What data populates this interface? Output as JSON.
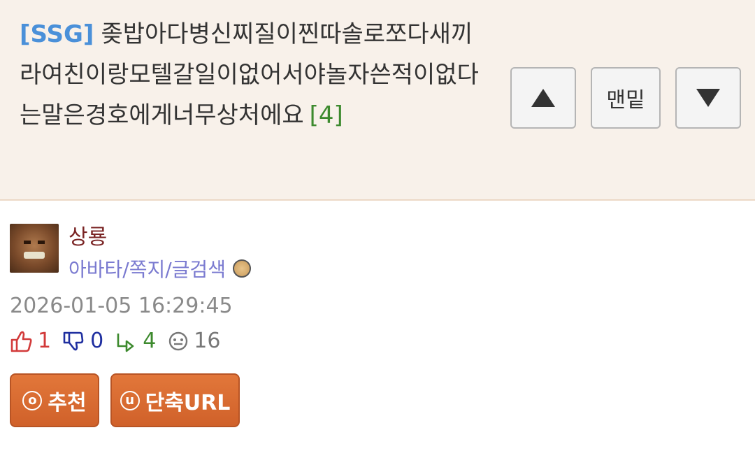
{
  "post": {
    "tag": "[SSG]",
    "title": "좆밥아다병신찌질이찐따솔로쪼다새끼라여친이랑모텔갈일이없어서야놀자쓴적이없다는말은경호에게너무상처에요",
    "comment_count": "[4]"
  },
  "nav": {
    "up_label": "▲",
    "bottom_label": "맨밑",
    "down_label": "▼"
  },
  "author": {
    "name": "상룡",
    "links": "아바타/쪽지/글검색",
    "badge_icon": "level-badge-icon"
  },
  "meta": {
    "datetime": "2026-01-05 16:29:45"
  },
  "stats": {
    "upvotes": "1",
    "downvotes": "0",
    "replies": "4",
    "views": "16"
  },
  "actions": {
    "recommend_icon": "o",
    "recommend_label": "추천",
    "shorturl_icon": "u",
    "shorturl_label": "단축URL"
  },
  "colors": {
    "header_bg": "#f8f1ea",
    "tag": "#4a90d9",
    "count": "#3d8a2e",
    "username": "#7a2424",
    "links": "#7a7ad0",
    "button": "#d86a30"
  }
}
